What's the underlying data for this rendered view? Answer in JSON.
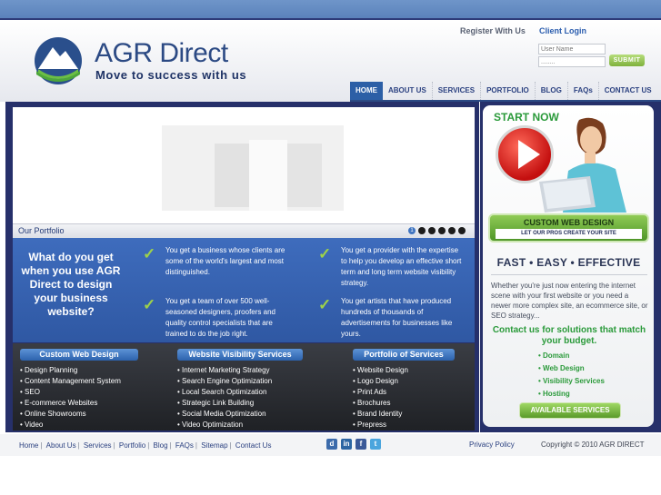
{
  "header": {
    "register_label": "Register With Us",
    "client_login_label": "Client Login",
    "username_placeholder": "User Name",
    "password_placeholder": "........",
    "submit_label": "SUBMIT"
  },
  "logo": {
    "name": "AGR Direct",
    "tagline": "Move to success with us"
  },
  "nav": {
    "items": [
      "HOME",
      "ABOUT US",
      "SERVICES",
      "PORTFOLIO",
      "BLOG",
      "FAQs",
      "CONTACT US"
    ],
    "active": "HOME"
  },
  "slider": {
    "label": "Our Portfolio",
    "pages": [
      "1",
      "2",
      "3",
      "4",
      "5",
      "6"
    ],
    "active_page": "1"
  },
  "features": {
    "question": "What do you get when you use AGR Direct to design your business website?",
    "items": [
      "You get a business whose clients are some of the world's largest and most distinguished.",
      "You get a provider with the expertise to help you develop an effective short term and long term website visibility strategy.",
      "You get a team of over 500 well-seasoned designers, proofers and quality control specialists that are trained to do the job right.",
      "You get artists that have produced hundreds of thousands of advertisements for businesses like yours."
    ]
  },
  "services": [
    {
      "title": "Custom Web Design",
      "items": [
        "Design Planning",
        "Content Management System",
        "SEO",
        "E-commerce Websites",
        "Online Showrooms",
        "Video"
      ]
    },
    {
      "title": "Website Visibility Services",
      "items": [
        "Internet Marketing Strategy",
        "Search Engine Optimization",
        "Local Search Optimization",
        "Strategic Link Building",
        "Social Media Optimization",
        "Video Optimization"
      ]
    },
    {
      "title": "Portfolio of Services",
      "items": [
        "Website Design",
        "Logo Design",
        "Print Ads",
        "Brochures",
        "Brand Identity",
        "Prepress"
      ]
    }
  ],
  "sidebar": {
    "start_now": "START NOW",
    "cwd_title": "CUSTOM WEB DESIGN",
    "cwd_sub": "LET OUR PROS CREATE YOUR SITE",
    "fee": "FAST • EASY • EFFECTIVE",
    "paragraph": "Whether you're just now entering the internet scene with your first website or you need a newer more complex site, an ecommerce site, or SEO strategy...",
    "contact_heading": "Contact us for solutions that match your budget.",
    "list": [
      "Domain",
      "Web Design",
      "Visibility Services",
      "Hosting"
    ],
    "avail_label": "AVAILABLE SERVICES"
  },
  "footer": {
    "links": [
      "Home",
      "About Us",
      "Services",
      "Portfolio",
      "Blog",
      "FAQs",
      "Sitemap",
      "Contact Us"
    ],
    "social": [
      "digg-icon",
      "linkedin-icon",
      "facebook-icon",
      "twitter-icon"
    ],
    "privacy": "Privacy Policy",
    "copyright": "Copyright © 2010 AGR DIRECT"
  },
  "colors": {
    "brand_blue": "#2c4a84",
    "nav_active": "#2c5fa6",
    "accent_green": "#2a9a3a",
    "panel_navy": "#26306a"
  }
}
